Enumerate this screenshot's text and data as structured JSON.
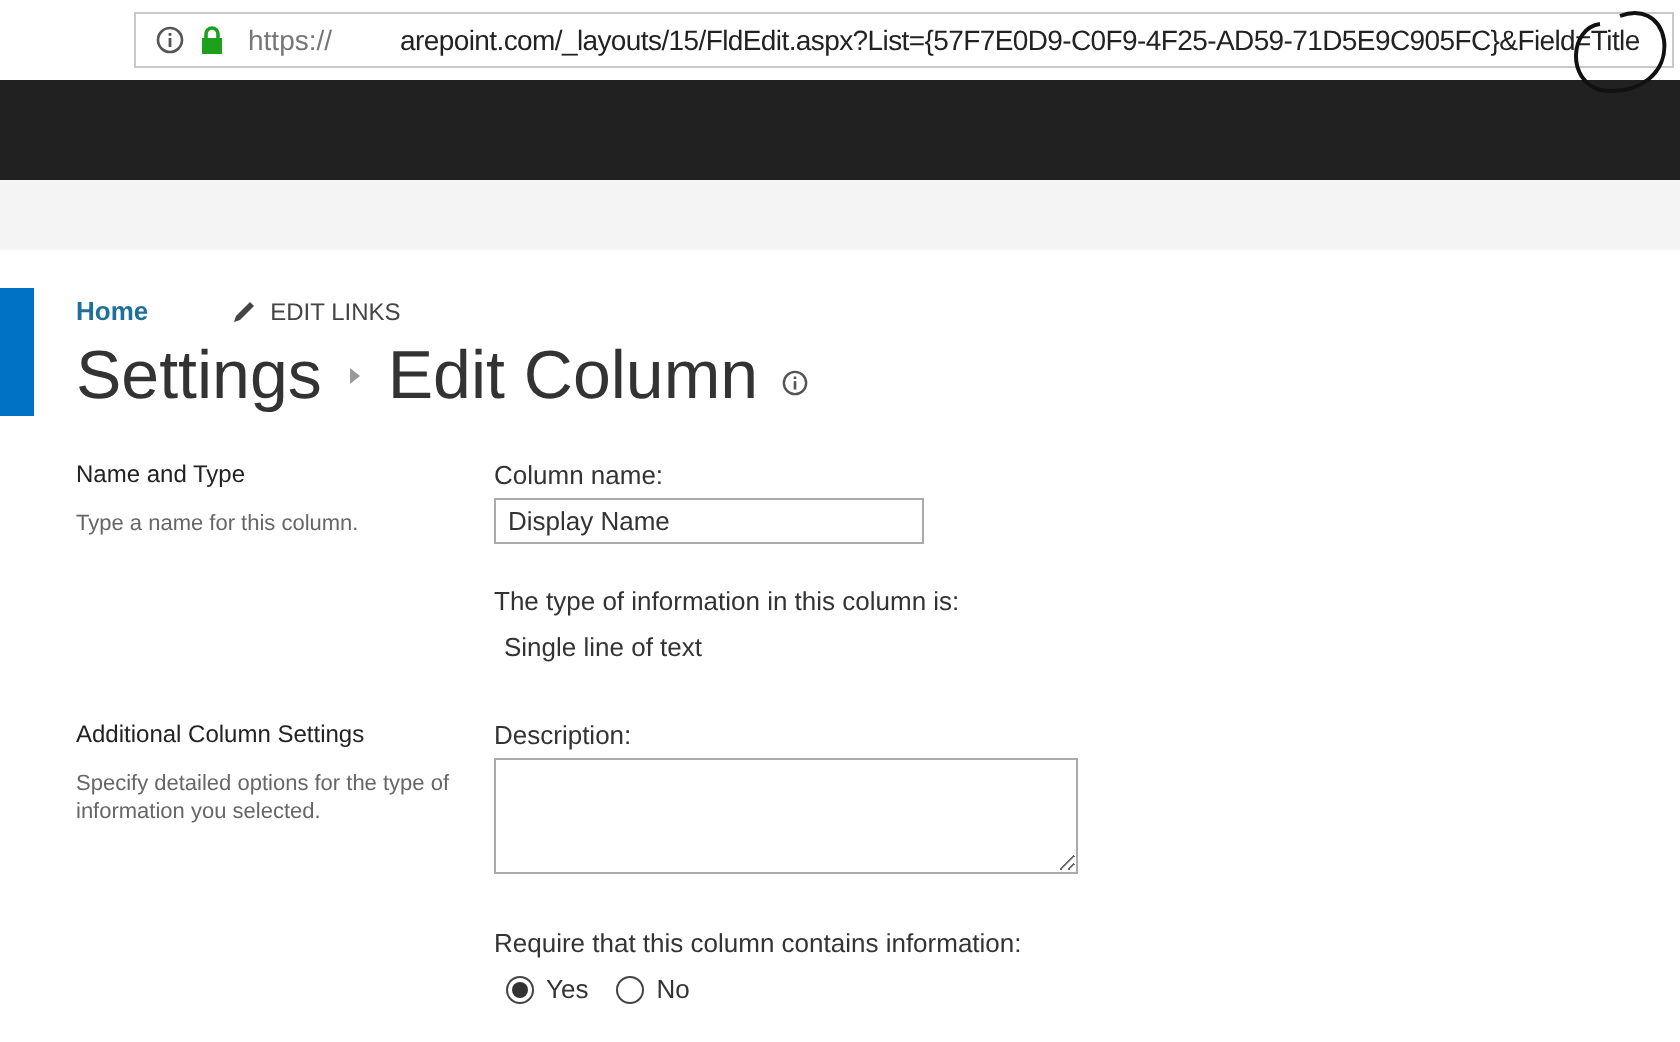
{
  "address_bar": {
    "scheme": "https://",
    "url": "arepoint.com/_layouts/15/FldEdit.aspx?List={57F7E0D9-C0F9-4F25-AD59-71D5E9C905FC}&Field=Title"
  },
  "breadcrumb": {
    "home": "Home",
    "edit_links": "EDIT LINKS"
  },
  "page_title": {
    "parent": "Settings",
    "current": "Edit Column"
  },
  "sections": [
    {
      "title": "Name and Type",
      "description": "Type a name for this column.",
      "fields": [
        {
          "kind": "input",
          "label": "Column name:",
          "value": "Display Name"
        },
        {
          "kind": "info",
          "label": "The type of information in this column is:",
          "value": "Single line of text"
        }
      ]
    },
    {
      "title": "Additional Column Settings",
      "description": "Specify detailed options for the type of information you selected.",
      "fields": [
        {
          "kind": "textarea",
          "label": "Description:"
        },
        {
          "kind": "radio",
          "label": "Require that this column contains information:",
          "options": [
            {
              "label": "Yes",
              "selected": true
            },
            {
              "label": "No",
              "selected": false
            }
          ]
        }
      ]
    }
  ]
}
